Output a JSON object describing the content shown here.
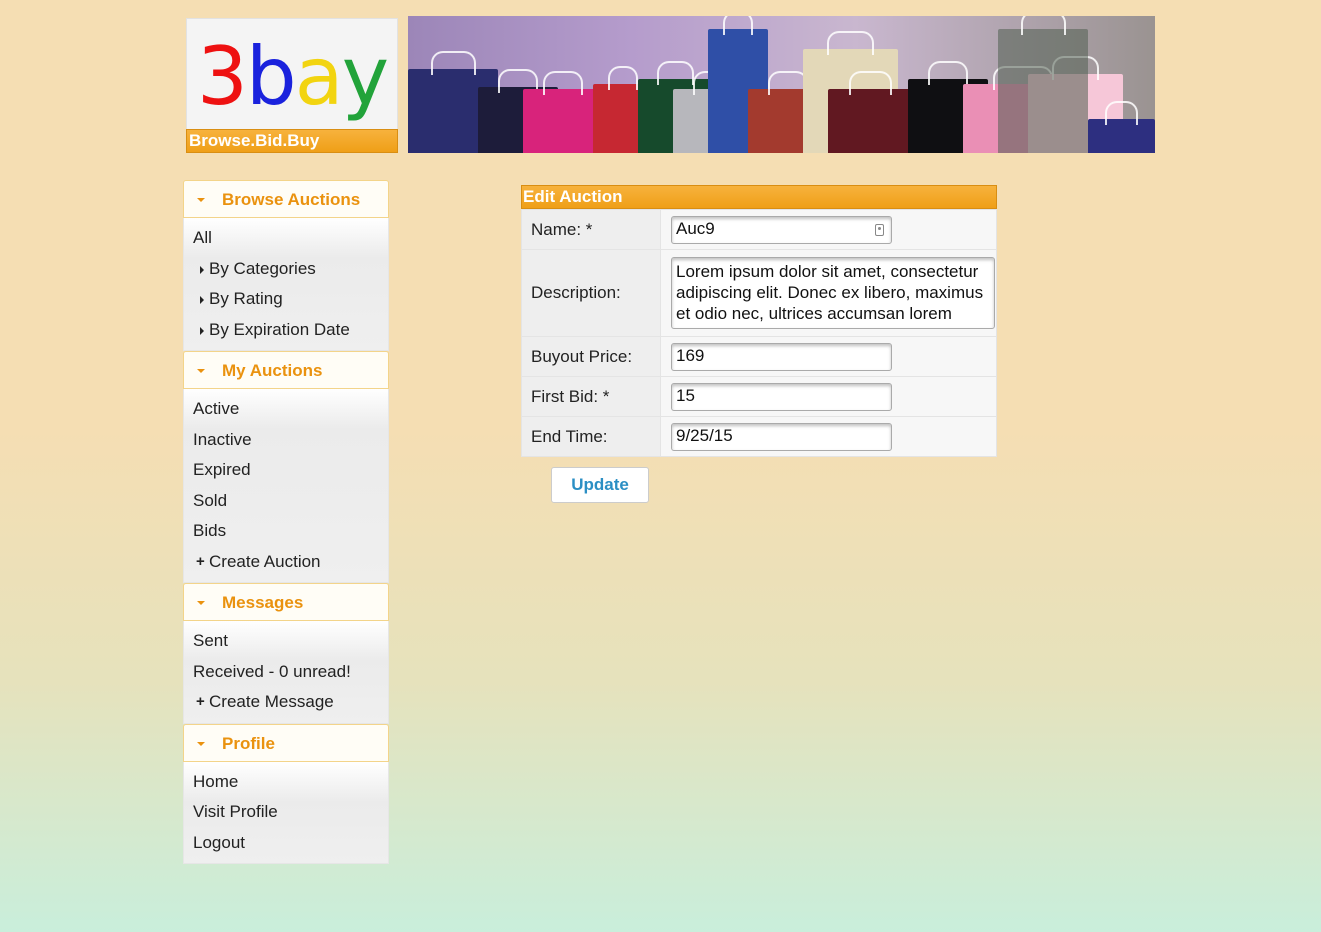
{
  "logo": {
    "letters": [
      "3",
      "b",
      "a",
      "y"
    ],
    "colors": [
      "#ee1111",
      "#1a22dd",
      "#f2d410",
      "#22a33a"
    ],
    "tagline": "Browse.Bid.Buy"
  },
  "banner": {
    "image": "shopping-bags-photo"
  },
  "sidebar": {
    "sections": [
      {
        "title": "Browse Auctions",
        "items": [
          "All",
          "By Categories",
          "By Rating",
          "By Expiration Date"
        ]
      },
      {
        "title": "My Auctions",
        "items": [
          "Active",
          "Inactive",
          "Expired",
          "Sold",
          "Bids",
          "Create Auction"
        ]
      },
      {
        "title": "Messages",
        "items": [
          "Sent",
          "Received - 0 unread!",
          "Create Message"
        ]
      },
      {
        "title": "Profile",
        "items": [
          "Home",
          "Visit Profile",
          "Logout"
        ]
      }
    ]
  },
  "form": {
    "title": "Edit Auction",
    "name_label": "Name:  *",
    "name_value": "Auc9",
    "description_label": "Description:",
    "description_value": "Lorem ipsum dolor sit amet, consectetur adipiscing elit. Donec ex libero, maximus et odio nec, ultrices accumsan lorem sagittis. Sed",
    "buyout_label": "Buyout Price:",
    "buyout_value": "169",
    "firstbid_label": "First Bid:  *",
    "firstbid_value": "15",
    "endtime_label": "End Time:",
    "endtime_value": "9/25/15",
    "update_label": "Update"
  },
  "colors": {
    "accent": "#ef9f17",
    "link_button": "#2b8fc4",
    "heading": "#ea920f"
  }
}
